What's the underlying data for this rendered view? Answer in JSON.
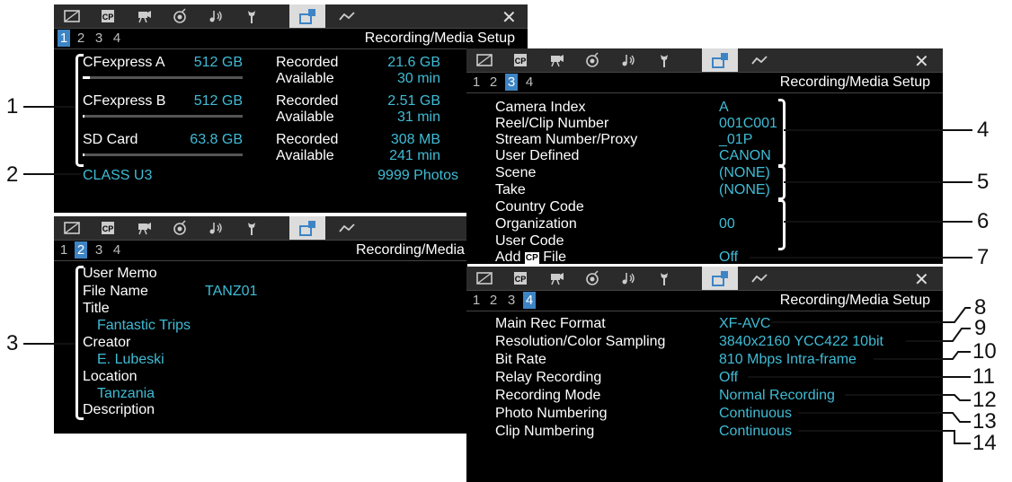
{
  "tabs": [
    "image-tab",
    "cp-tab",
    "camera-tab",
    "assign-tab",
    "audio-tab",
    "wrench-tab",
    "recording-media-tab",
    "network-tab"
  ],
  "colors": {
    "accent_cyan": "#3fbcd6",
    "active_page": "#3d84c5",
    "active_tab": "#dcdcdc"
  },
  "close_symbol": "✕",
  "title": "Recording/Media Setup",
  "page_numbers": [
    "1",
    "2",
    "3",
    "4"
  ],
  "screen1": {
    "active_page": 1,
    "cards": [
      {
        "name": "CFexpress A",
        "capacity": "512 GB",
        "recorded_label": "Recorded",
        "recorded": "21.6 GB",
        "available_label": "Available",
        "available": "30 min",
        "used_fraction": 0.04
      },
      {
        "name": "CFexpress B",
        "capacity": "512 GB",
        "recorded_label": "Recorded",
        "recorded": "2.51 GB",
        "available_label": "Available",
        "available": "31 min",
        "used_fraction": 0.0
      },
      {
        "name": "SD Card",
        "capacity": "63.8 GB",
        "recorded_label": "Recorded",
        "recorded": "308 MB",
        "available_label": "Available",
        "available": "241 min",
        "used_fraction": 0.0
      }
    ],
    "class": "CLASS U3",
    "photos": "9999 Photos"
  },
  "screen2": {
    "active_page": 2,
    "title_truncated": "Recording/Media",
    "user_memo": "User Memo",
    "file_name_label": "File Name",
    "file_name": "TANZ01",
    "title_label": "Title",
    "title_value": "Fantastic Trips",
    "creator_label": "Creator",
    "creator": "E. Lubeski",
    "location_label": "Location",
    "location": "Tanzania",
    "description_label": "Description"
  },
  "screen3": {
    "active_page": 3,
    "rows": [
      {
        "label": "Camera Index",
        "value": "A"
      },
      {
        "label": "Reel/Clip Number",
        "value": "001C001"
      },
      {
        "label": "Stream Number/Proxy",
        "value": "_01P"
      },
      {
        "label": "User Defined",
        "value": "CANON"
      },
      {
        "label": "Scene",
        "value": "(NONE)"
      },
      {
        "label": "Take",
        "value": "(NONE)"
      },
      {
        "label": "Country Code",
        "value": ""
      },
      {
        "label": "Organization",
        "value": "00"
      },
      {
        "label": "User Code",
        "value": ""
      }
    ],
    "add_file_prefix": "Add",
    "add_file_icon": "CP",
    "add_file_suffix": "File",
    "add_file_value": "Off"
  },
  "screen4": {
    "active_page": 4,
    "rows": [
      {
        "label": "Main Rec Format",
        "value": "XF-AVC"
      },
      {
        "label": "Resolution/Color Sampling",
        "value": "3840x2160 YCC422 10bit"
      },
      {
        "label": "Bit Rate",
        "value": "810 Mbps Intra-frame"
      },
      {
        "label": "Relay Recording",
        "value": "Off"
      },
      {
        "label": "Recording Mode",
        "value": "Normal Recording"
      },
      {
        "label": "Photo Numbering",
        "value": "Continuous"
      },
      {
        "label": "Clip Numbering",
        "value": "Continuous"
      }
    ]
  },
  "callouts": [
    "1",
    "2",
    "3",
    "4",
    "5",
    "6",
    "7",
    "8",
    "9",
    "10",
    "11",
    "12",
    "13",
    "14"
  ]
}
